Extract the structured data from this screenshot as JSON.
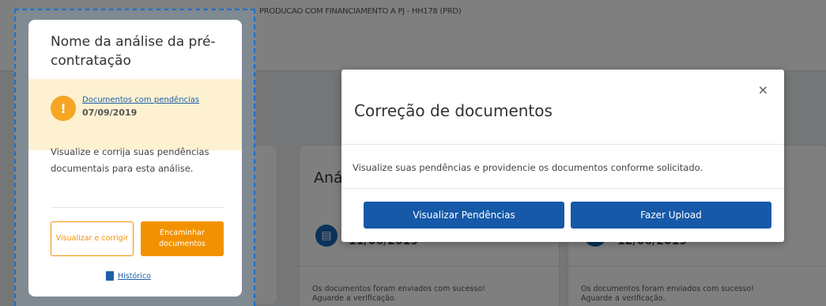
{
  "background": {
    "topbar_text": "PRODUCAO COM FINANCIAMENTO A PJ - HH178 (PRD)",
    "card_1": {
      "title": "Aná",
      "date": "11/06/2019",
      "message": "Os documentos foram enviados com sucesso! Aguarde a verificação."
    },
    "card_2": {
      "date": "12/06/2019",
      "message": "Os documentos foram enviados com sucesso! Aguarde a verificação."
    }
  },
  "focus_card": {
    "title": "Nome da análise da pré-contratação",
    "status_icon": "!",
    "status_link": "Documentos com pendências",
    "status_date": "07/09/2019",
    "description": "Visualize e corrija suas pendências documentais para esta análise.",
    "view_fix_label": "Visualizar e corrigir",
    "forward_label": "Encaminhar documentos",
    "history_label": "Histórico"
  },
  "modal": {
    "title": "Correção de documentos",
    "close_symbol": "×",
    "body": "Visualize suas pendências e providencie os documentos conforme solicitado.",
    "view_pending_label": "Visualizar Pendências",
    "upload_label": "Fazer Upload"
  },
  "colors": {
    "accent_orange": "#f39200",
    "primary_blue": "#1559a8",
    "warning_bg": "#fdf1d2"
  }
}
